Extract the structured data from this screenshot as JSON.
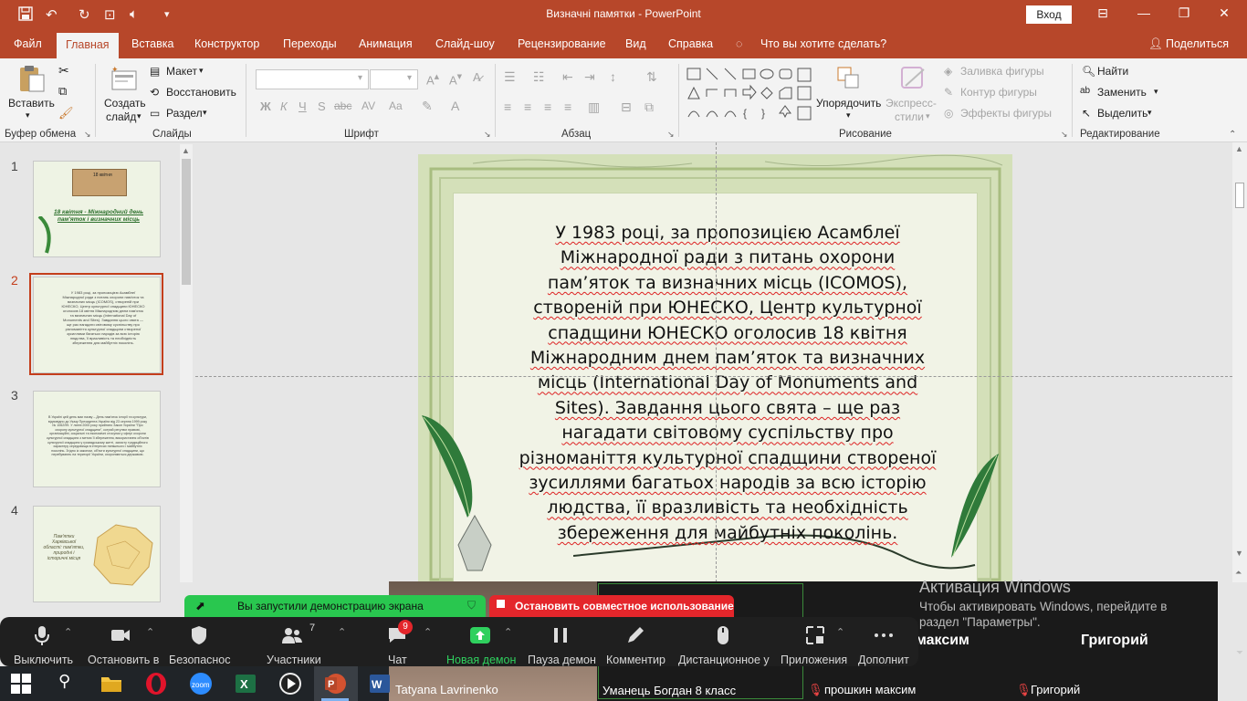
{
  "titlebar": {
    "title": "Визначні памятки  -  PowerPoint",
    "signin": "Вход",
    "min": "—",
    "restore": "❐",
    "close": "✕"
  },
  "tabs": {
    "file": "Файл",
    "home": "Главная",
    "insert": "Вставка",
    "design": "Конструктор",
    "transitions": "Переходы",
    "animation": "Анимация",
    "slideshow": "Слайд-шоу",
    "review": "Рецензирование",
    "view": "Вид",
    "help": "Справка",
    "search": "Что вы хотите сделать?",
    "share": "Поделиться"
  },
  "ribbon": {
    "clipboard": {
      "paste": "Вставить",
      "group": "Буфер обмена"
    },
    "slides": {
      "new_slide_1": "Создать",
      "new_slide_2": "слайд",
      "layout": "Макет",
      "reset": "Восстановить",
      "section": "Раздел",
      "group": "Слайды"
    },
    "font": {
      "bold": "Ж",
      "italic": "К",
      "underline": "Ч",
      "shadow": "S",
      "strike": "abc",
      "spacing": "AV",
      "case": "Aa",
      "group": "Шрифт"
    },
    "paragraph": {
      "group": "Абзац"
    },
    "drawing": {
      "arrange_1": "Упорядочить",
      "quick_styles_1": "Экспресс-",
      "quick_styles_2": "стили",
      "fill": "Заливка фигуры",
      "outline": "Контур фигуры",
      "effects": "Эффекты фигуры",
      "group": "Рисование"
    },
    "editing": {
      "find": "Найти",
      "replace": "Заменить",
      "select": "Выделить",
      "group": "Редактирование"
    }
  },
  "thumbnails": {
    "nums": [
      "1",
      "2",
      "3",
      "4"
    ],
    "slide1_title": "18 квітня - Міжнародний день пам'яток і визначних місць",
    "slide1_card": "18 квітня",
    "slide2_text": "У 1983 році, за пропозицією Асамблеї Міжнародної ради з питань охорони пам'яток та визначних місць (ICOMOS), створеній при ЮНЕСКО, Центр культурної спадщини ЮНЕСКО оголосив 18 квітня Міжнародним днем пам'яток та визначних місць (International Day of Monuments and Sites). Завдання цього свята — ще раз нагадати світовому суспільству про різноманіття культурної спадщини створеної зусиллями багатьох народів за всю історію людства, її вразливість та необхідність збереження для майбутніх поколінь.",
    "slide3_text": "В Україні цей день має назву – День пам'яток історії та культури, відповідно до Указу Президента України від 23 серпня 1999 року № 1062/99. У липні 2000 року прийнято Закон України \"Про охорону культурної спадщини\", котрий регулює правові, організаційні, соціальні та економічні стосунки у сфері охорони культурної спадщини з метою її збереження, використання об'єктів культурної спадщини у громадському житті, захисту традиційного характеру середовища в інтересах нинішнього і майбутніх поколінь. Згідно із законом, об'єкти культурної спадщини, що перебувають на території України, охороняються державою.",
    "slide4_text": "Пам'ятки Харківської області: пам'ятки, природні і історичні місця"
  },
  "slide": {
    "line1": "У 1983 році, за пропозицією Асамблеї",
    "line2": "Міжнародної ради з питань охорони",
    "line3": "пам’яток та визначних місць (ICOMOS),",
    "line4": "створеній при ЮНЕСКО, Центр культурної",
    "line5": "спадщини ЮНЕСКО оголосив 18 квітня",
    "line6": "Міжнародним днем пам’яток та визначних",
    "line7": "місць (International Day of Monuments and",
    "line8": "Sites). Завдання цього свята – ще раз",
    "line9": "нагадати світовому суспільству про",
    "line10": "різноманіття культурної спадщини створеної",
    "line11": "зусиллями багатьох народів за всю історію",
    "line12": "людства, її вразливість та необхідність",
    "line13": "збереження для майбутніх поколінь."
  },
  "zoom": {
    "share_banner": "Вы запустили демонстрацию экрана",
    "stop_banner": "Остановить совместное использование",
    "participant_count": "7",
    "chat_count": "9",
    "buttons": {
      "mute": "Выключить",
      "video": "Остановить в",
      "security": "Безопаснос",
      "participants": "Участники",
      "chat": "Чат",
      "share": "Новая демон",
      "pause": "Пауза демон",
      "annotate": "Комментир",
      "remote": "Дистанционное у",
      "apps": "Приложения",
      "more": "Дополнит"
    },
    "tiles": {
      "t1_name": "Tatyana Lavrinenko",
      "t2_name": "Уманець Богдан 8 класс",
      "t3_big": "максим",
      "t3_name": "прошкин максим",
      "t4_big": "Григорий",
      "t4_name": "Григорий"
    }
  },
  "activation": {
    "title": "Активация Windows",
    "line1": "Чтобы активировать Windows, перейдите в",
    "line2": "раздел \"Параметры\"."
  },
  "colors": {
    "ppt_accent": "#b7472a",
    "selected": "#c43e1c",
    "zoom_green": "#29c74f",
    "zoom_red": "#e4262b"
  }
}
